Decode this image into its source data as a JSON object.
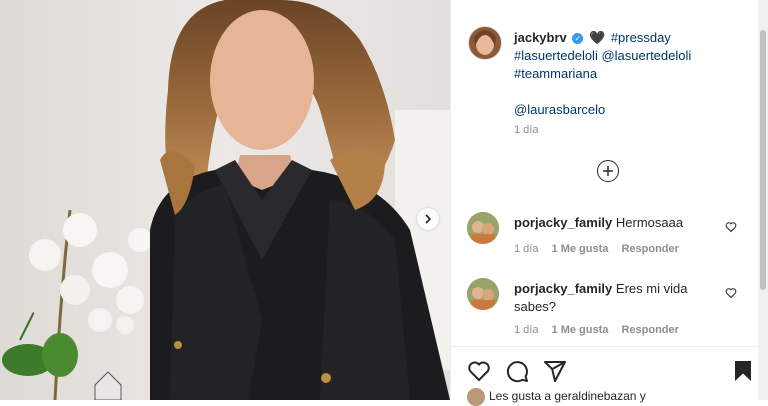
{
  "post": {
    "author": "jackybrv",
    "caption_hashtag_1": "#pressday",
    "caption_hashtag_2": "#lasuertedeloli",
    "caption_mention_1": "@lasuertedeloli",
    "caption_hashtag_3": "#teammariana",
    "caption_mention_2": "@laurasbarcelo",
    "time": "1 día",
    "heart_emoji": "🖤"
  },
  "comments": [
    {
      "user": "porjacky_family",
      "text": "Hermosaaa",
      "time": "1 día",
      "likes": "1 Me gusta",
      "reply": "Responder"
    },
    {
      "user": "porjacky_family",
      "text": "Eres mi vida sabes?",
      "time": "1 día",
      "likes": "1 Me gusta",
      "reply": "Responder"
    }
  ],
  "actions": {
    "liked_by": "Les gusta a geraldinebazan y"
  },
  "icons": {
    "verified": "verified-badge-icon",
    "load_more": "plus-circle-icon",
    "like": "heart-icon",
    "comment": "comment-icon",
    "share": "paper-plane-icon",
    "save": "bookmark-icon",
    "next": "chevron-right-icon"
  },
  "colors": {
    "link": "#00376b",
    "verified": "#3897f0",
    "meta": "#8e8e8e",
    "text": "#262626"
  }
}
